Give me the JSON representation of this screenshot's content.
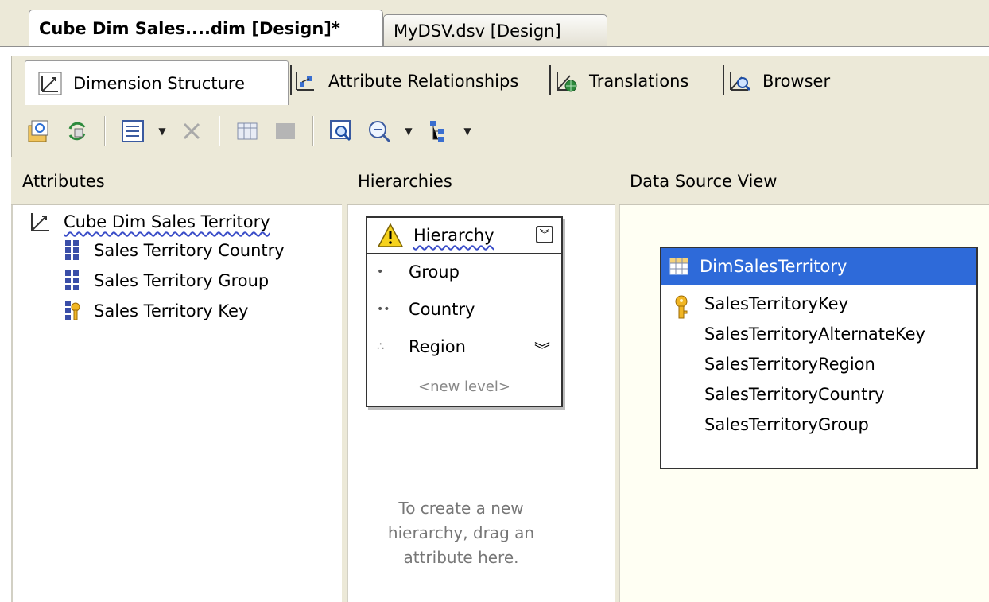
{
  "doc_tabs": [
    {
      "label": "Cube Dim Sales....dim [Design]*",
      "active": true
    },
    {
      "label": "MyDSV.dsv [Design]",
      "active": false
    }
  ],
  "designer_tabs": [
    {
      "label": "Dimension Structure",
      "icon": "dimension-structure-icon"
    },
    {
      "label": "Attribute Relationships",
      "icon": "attribute-relationships-icon"
    },
    {
      "label": "Translations",
      "icon": "translations-icon"
    },
    {
      "label": "Browser",
      "icon": "browser-icon"
    }
  ],
  "panes": {
    "attributes": {
      "title": "Attributes"
    },
    "hierarchies": {
      "title": "Hierarchies"
    },
    "dsv": {
      "title": "Data Source View"
    }
  },
  "attributes": {
    "root": "Cube Dim Sales Territory",
    "items": [
      {
        "label": "Sales Territory Country",
        "icon": "attribute-icon"
      },
      {
        "label": "Sales Territory Group",
        "icon": "attribute-icon"
      },
      {
        "label": "Sales Territory Key",
        "icon": "key-attribute-icon"
      }
    ]
  },
  "hierarchy": {
    "title": "Hierarchy",
    "levels": [
      {
        "label": "Group",
        "marker": "•"
      },
      {
        "label": "Country",
        "marker": "••"
      },
      {
        "label": "Region",
        "marker": "∴"
      }
    ],
    "new_level": "<new level>",
    "hint": "To create a new hierarchy, drag an attribute here."
  },
  "dsv_table": {
    "name": "DimSalesTerritory",
    "columns": [
      "SalesTerritoryKey",
      "SalesTerritoryAlternateKey",
      "SalesTerritoryRegion",
      "SalesTerritoryCountry",
      "SalesTerritoryGroup"
    ]
  },
  "colors": {
    "table_header": "#2e6ad9",
    "chrome": "#ece9d8"
  }
}
